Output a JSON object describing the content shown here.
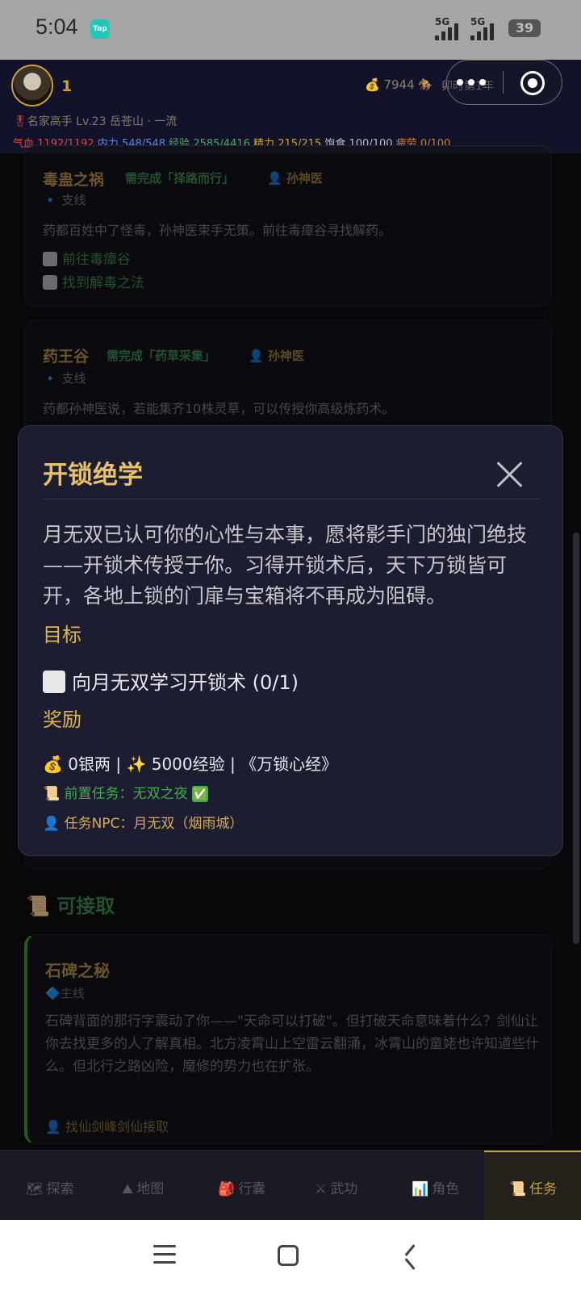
{
  "status_bar": {
    "time": "5:04",
    "app_badge": "Tap",
    "signal_labels": [
      "5G",
      "5G"
    ],
    "battery": "39"
  },
  "header": {
    "player_number": "1",
    "money": "7944",
    "date_partial": "卯时第1年",
    "rank_medal": "🎖",
    "rank_text": "名家高手 Lv.23 岳苍山 · 一流",
    "stats": {
      "hp_label": "气血",
      "hp": "1192/1192",
      "mp_label": "内力",
      "mp": "548/548",
      "exp_label": "经验",
      "exp": "2585/4416",
      "energy_label": "精力",
      "energy": "215/215",
      "food_label": "饱食",
      "food": "100/100",
      "fatigue_label": "疲劳",
      "fatigue": "0/100"
    }
  },
  "quests": [
    {
      "title": "毒蛊之祸",
      "requirement": "需完成「择路而行」",
      "npc": "👤 孙神医",
      "type": "🔹 支线",
      "description": "药都百姓中了怪毒，孙神医束手无策。前往毒瘴谷寻找解药。",
      "objectives": [
        "前往毒瘴谷",
        "找到解毒之法"
      ]
    },
    {
      "title": "药王谷",
      "requirement": "需完成「药草采集」",
      "npc": "👤 孙神医",
      "type": "🔹 支线",
      "description": "药都孙神医说，若能集齐10株灵草，可以传授你高级炼药术。"
    }
  ],
  "available": {
    "heading_icon": "📜",
    "heading": "可接取",
    "quest": {
      "title": "石碑之秘",
      "type_icon": "🔷",
      "type": "主线",
      "description": "石碑背面的那行字震动了你——\"天命可以打破\"。但打破天命意味着什么？剑仙让你去找更多的人了解真相。北方凌霄山上空雷云翻涌，冰霄山的童姥也许知道些什么。但北行之路凶险，魔修的势力也在扩张。",
      "npc_icon": "👤",
      "npc": "找仙剑峰剑仙接取"
    }
  },
  "modal": {
    "title": "开锁绝学",
    "description": "月无双已认可你的心性与本事，愿将影手门的独门绝技——开锁术传授于你。习得开锁术后，天下万锁皆可开，各地上锁的门扉与宝箱将不再成为阻碍。",
    "objective_heading": "目标",
    "objective": "向月无双学习开锁术 (0/1)",
    "reward_heading": "奖励",
    "rewards": {
      "coin_icon": "💰",
      "silver": "0银两",
      "exp_icon": "✨",
      "exp": "5000经验",
      "item": "《万锁心经》"
    },
    "prerequisite_icon": "📜",
    "prerequisite": "前置任务：无双之夜",
    "prerequisite_check": "✅",
    "npc_icon": "👤",
    "npc": "任务NPC：月无双（烟雨城）"
  },
  "tabs": [
    {
      "icon": "🗺",
      "label": "探索"
    },
    {
      "icon": "⛰",
      "label": "地图"
    },
    {
      "icon": "🎒",
      "label": "行囊"
    },
    {
      "icon": "⚔",
      "label": "武功"
    },
    {
      "icon": "📊",
      "label": "角色"
    },
    {
      "icon": "📜",
      "label": "任务",
      "active": true
    }
  ],
  "colors": {
    "gold": "#c9a23c",
    "modal_bg": "#1d1d31",
    "objective_green": "#3f8a52",
    "hp_red": "#d84848",
    "mp_blue": "#5b86e0"
  }
}
